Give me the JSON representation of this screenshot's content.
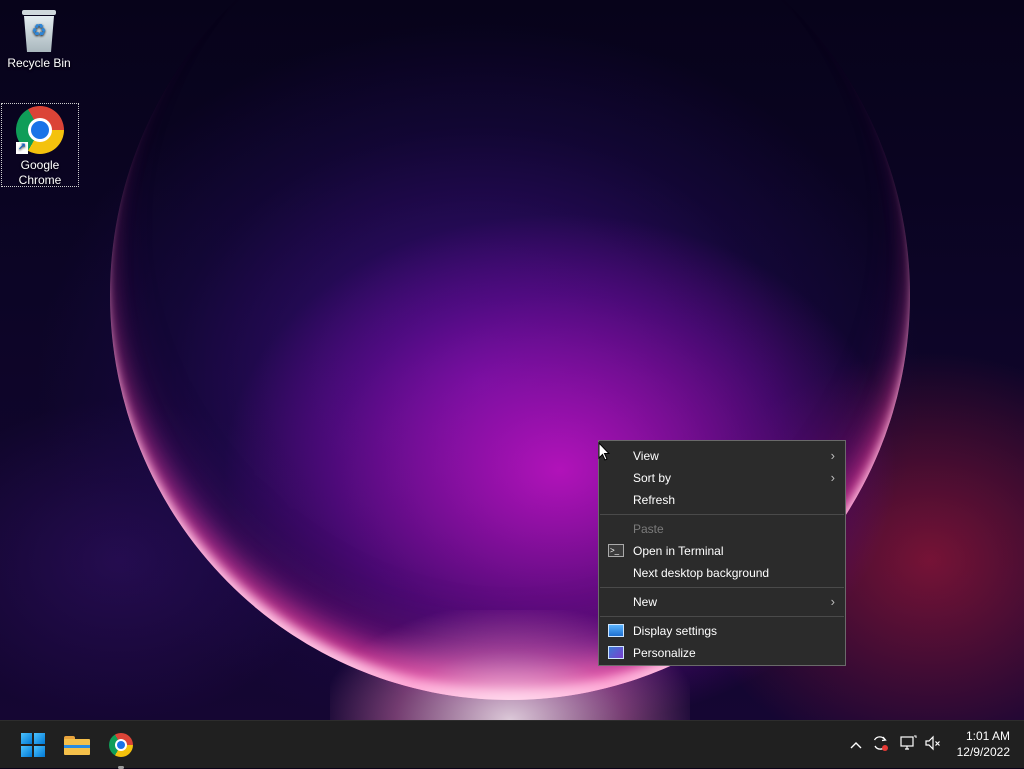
{
  "desktop": {
    "icons": [
      {
        "label": "Recycle Bin"
      },
      {
        "label": "Google\nChrome",
        "line1": "Google",
        "line2": "Chrome"
      }
    ]
  },
  "context_menu": {
    "items": [
      {
        "label": "View",
        "has_submenu": true
      },
      {
        "label": "Sort by",
        "has_submenu": true
      },
      {
        "label": "Refresh"
      },
      {
        "label": "Paste",
        "disabled": true
      },
      {
        "label": "Open in Terminal",
        "icon": "terminal-icon"
      },
      {
        "label": "Next desktop background"
      },
      {
        "label": "New",
        "has_submenu": true
      },
      {
        "label": "Display settings",
        "icon": "display-settings-icon"
      },
      {
        "label": "Personalize",
        "icon": "personalize-icon"
      }
    ],
    "submenu_glyph": "›"
  },
  "taskbar": {
    "pinned": [
      "start-button",
      "file-explorer",
      "google-chrome"
    ],
    "tray": {
      "chevron": "^",
      "icons": [
        "show-hidden-icons-chevron",
        "sync-icon",
        "network-icon",
        "volume-muted-icon"
      ]
    },
    "clock": {
      "time": "1:01 AM",
      "date": "12/9/2022"
    }
  },
  "colors": {
    "menu_bg": "#2b2b2b",
    "taskbar_bg": "#202020",
    "accent": "#0078d4"
  }
}
